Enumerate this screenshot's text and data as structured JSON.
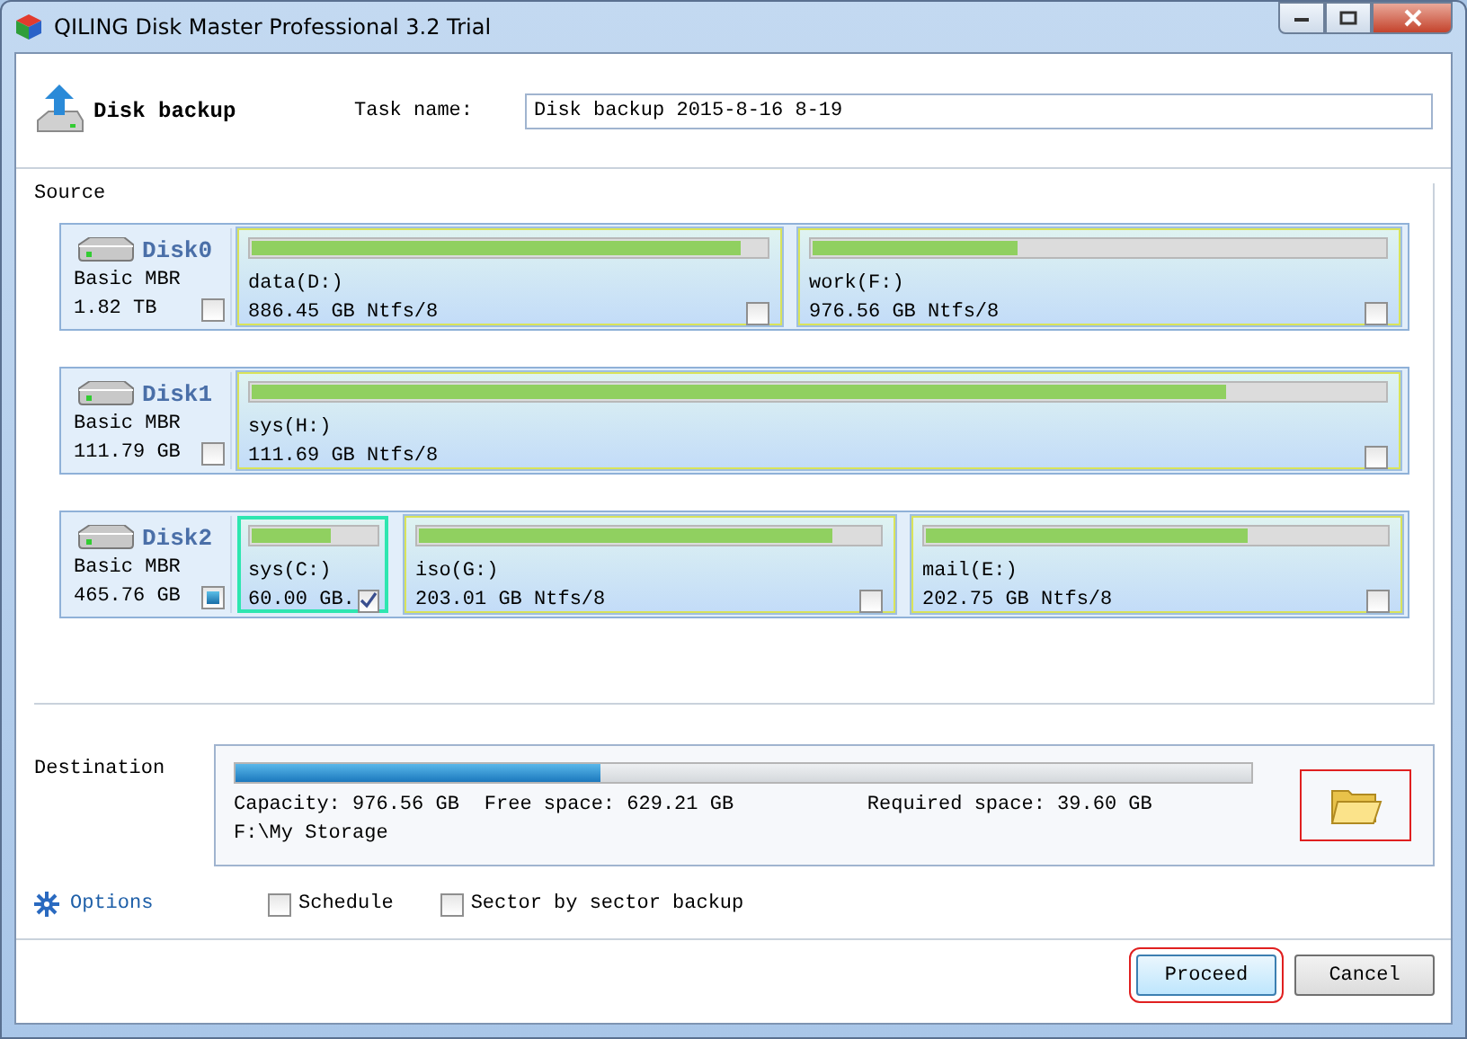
{
  "window": {
    "title": "QILING Disk Master Professional 3.2 Trial"
  },
  "header": {
    "title": "Disk backup",
    "task_label": "Task name:",
    "task_name": "Disk backup 2015-8-16 8-19"
  },
  "source": {
    "label": "Source",
    "disks": [
      {
        "name": "Disk0",
        "type": "Basic MBR",
        "size": "1.82 TB",
        "checked": false,
        "partial": false,
        "partitions": [
          {
            "label": "data(D:)",
            "info": "886.45 GB Ntfs/8",
            "level": 0.95,
            "checked": false,
            "selected": false
          },
          {
            "label": "work(F:)",
            "info": "976.56 GB Ntfs/8",
            "level": 0.36,
            "checked": false,
            "selected": false
          }
        ]
      },
      {
        "name": "Disk1",
        "type": "Basic MBR",
        "size": "111.79 GB",
        "checked": false,
        "partial": false,
        "partitions": [
          {
            "label": "sys(H:)",
            "info": "111.69 GB Ntfs/8",
            "level": 0.86,
            "checked": false,
            "selected": false
          }
        ]
      },
      {
        "name": "Disk2",
        "type": "Basic MBR",
        "size": "465.76 GB",
        "checked": false,
        "partial": true,
        "partitions": [
          {
            "label": "sys(C:)",
            "info": "60.00 GB.",
            "level": 0.64,
            "checked": true,
            "selected": true
          },
          {
            "label": "iso(G:)",
            "info": "203.01 GB Ntfs/8",
            "level": 0.9,
            "checked": false,
            "selected": false
          },
          {
            "label": "mail(E:)",
            "info": "202.75 GB Ntfs/8",
            "level": 0.7,
            "checked": false,
            "selected": false
          }
        ]
      }
    ]
  },
  "destination": {
    "label": "Destination",
    "level": 0.36,
    "capacity": "Capacity: 976.56 GB",
    "free": "Free space: 629.21 GB",
    "required": "Required space: 39.60 GB",
    "path": "F:\\My Storage"
  },
  "options": {
    "label": "Options",
    "checkboxes": [
      {
        "label": "Schedule",
        "checked": false
      },
      {
        "label": "Sector by sector backup",
        "checked": false
      }
    ]
  },
  "buttons": [
    {
      "label": "Proceed",
      "selected": true
    },
    {
      "label": "Cancel",
      "selected": false
    }
  ]
}
